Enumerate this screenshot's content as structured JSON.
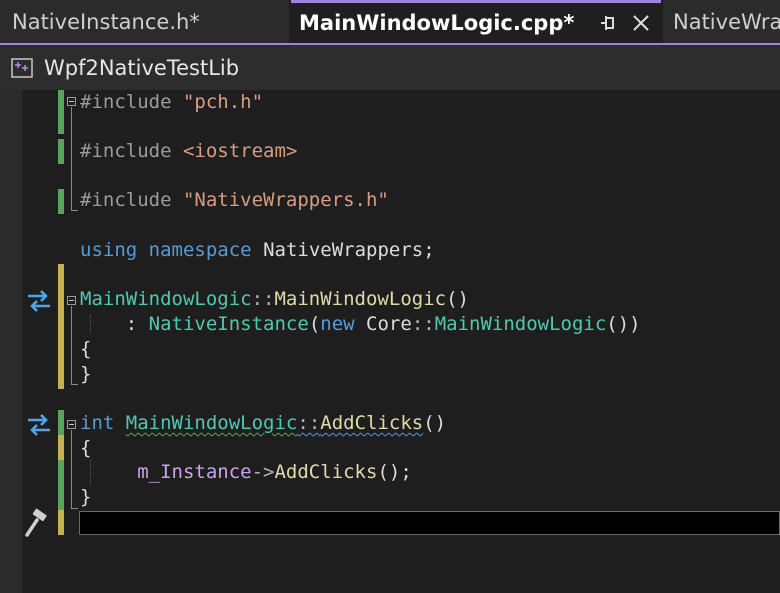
{
  "tabs": [
    {
      "label": "NativeInstance.h*",
      "active": false
    },
    {
      "label": "MainWindowLogic.cpp*",
      "active": true
    },
    {
      "label": "NativeWra",
      "active": false
    }
  ],
  "project": {
    "name": "Wpf2NativeTestLib",
    "icon": "cpp-project-icon"
  },
  "icons": {
    "pin": "pin-icon",
    "close": "close-icon",
    "navigate": "go-to-definition-icon",
    "build": "hammer-icon"
  },
  "colors": {
    "accent": "#9d84e0",
    "keyword": "#569cd6",
    "string": "#d69d85",
    "type": "#4ec9b0",
    "function": "#dcdcaa",
    "member": "#c8a4e8",
    "saved_change": "#5aa35a",
    "unsaved_change": "#c6b050"
  },
  "code": {
    "l1": {
      "directive": "#include",
      "value": "\"pch.h\""
    },
    "l2": {
      "directive": "#include",
      "value": "<iostream>"
    },
    "l3": {
      "directive": "#include",
      "value": "\"NativeWrappers.h\""
    },
    "l4": {
      "kw1": "using",
      "kw2": "namespace",
      "name": "NativeWrappers",
      "end": ";"
    },
    "l5": {
      "cls": "MainWindowLogic",
      "sep": "::",
      "fn": "MainWindowLogic",
      "args": "()"
    },
    "l6": {
      "colon": ": ",
      "base": "NativeInstance",
      "open": "(",
      "kw": "new",
      "ns": "Core",
      "sep": "::",
      "cls": "MainWindowLogic",
      "close": "())"
    },
    "l7": {
      "text": "{"
    },
    "l8": {
      "text": "}"
    },
    "l9": {
      "kw": "int",
      "cls": "MainWindowLogic",
      "sep": "::",
      "fn": "AddClicks",
      "args": "()"
    },
    "l10": {
      "text": "{"
    },
    "l11": {
      "member": "m_Instance",
      "arrow": "->",
      "fn": "AddClicks",
      "args": "();"
    },
    "l12": {
      "text": "}"
    }
  }
}
